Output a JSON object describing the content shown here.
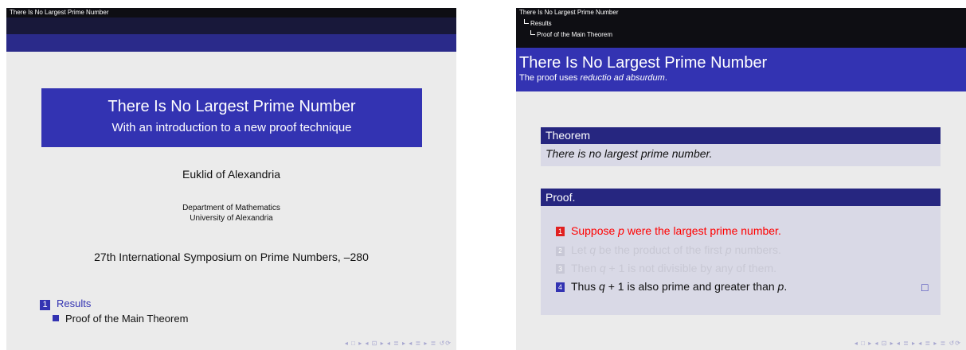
{
  "slide_left": {
    "header_text": "There Is No Largest Prime Number",
    "title": "There Is No Largest Prime Number",
    "subtitle": "With an introduction to a new proof technique",
    "author": "Euklid of Alexandria",
    "institute_line1": "Department of Mathematics",
    "institute_line2": "University of Alexandria",
    "conference": "27th International Symposium on Prime Numbers, –280",
    "toc": {
      "section_number": "1",
      "section": "Results",
      "subsection": "Proof of the Main Theorem"
    },
    "nav_glyphs": "◂ □ ▸ ◂ ⊡ ▸ ◂ ≣ ▸ ◂ ≣ ▸ ≣ ↺⟳"
  },
  "slide_right": {
    "crumb1": "There Is No Largest Prime Number",
    "crumb2": "Results",
    "crumb3": "Proof of the Main Theorem",
    "frame_title": "There Is No Largest Prime Number",
    "frame_subtitle_prefix": "The proof uses ",
    "frame_subtitle_italic": "reductio ad absurdum",
    "frame_subtitle_suffix": ".",
    "theorem_head": "Theorem",
    "theorem_body": "There is no largest prime number.",
    "proof_head": "Proof.",
    "steps": [
      {
        "num": "1",
        "a": "Suppose ",
        "var": "p",
        "b": " were the largest prime number."
      },
      {
        "num": "2",
        "a": "Let ",
        "var": "q",
        "b": " be the product of the first ",
        "var2": "p",
        "c": " numbers."
      },
      {
        "num": "3",
        "a": "Then ",
        "var": "q",
        "b": " + 1 is not divisible by any of them."
      },
      {
        "num": "4",
        "a": "Thus ",
        "var": "q",
        "b": " + 1 is also prime and greater than ",
        "var2": "p",
        "c": "."
      }
    ],
    "qed_symbol": "□",
    "nav_glyphs": "◂ □ ▸ ◂ ⊡ ▸ ◂ ≣ ▸ ◂ ≣ ▸ ≣ ↺⟳"
  },
  "colors": {
    "beamer_blue": "#3333b2",
    "header_black": "#0e0e13",
    "block_head": "#262680",
    "block_body": "#d9d9e6",
    "alert_red": "#ff0000"
  }
}
